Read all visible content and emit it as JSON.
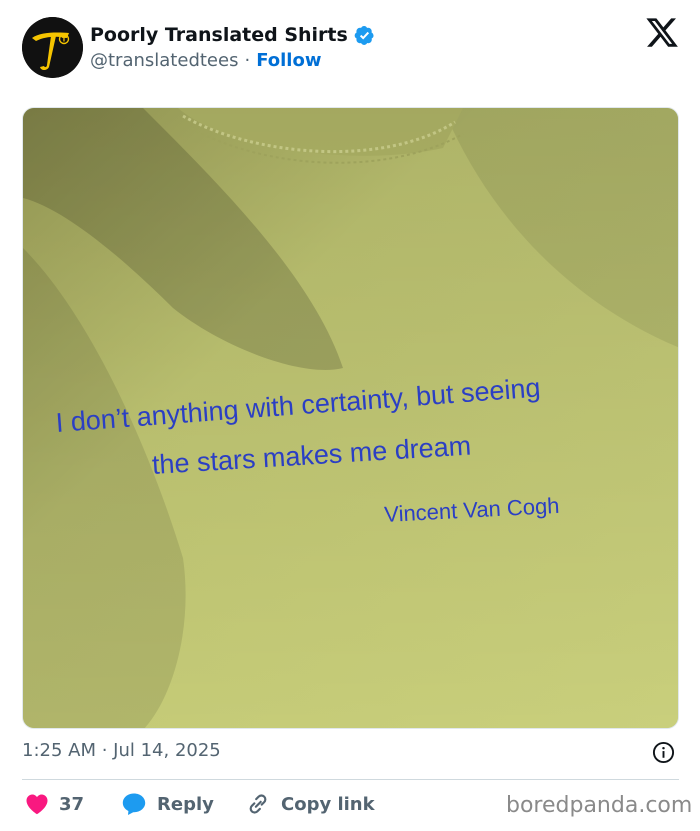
{
  "account": {
    "display_name": "Poorly Translated Shirts",
    "handle": "@translatedtees",
    "separator": "·",
    "follow_label": "Follow",
    "verified": true,
    "avatar_icon": "yellow-t-logo-icon"
  },
  "platform_icon": "x-logo-icon",
  "media": {
    "shirt_color": "#c4ca75",
    "print_color": "#2b3fc4",
    "text_lines": [
      "I don’t anything with certainty, but seeing",
      "the stars makes me dream",
      "Vincent Van Cogh"
    ]
  },
  "timestamp": "1:25 AM · Jul 14, 2025",
  "actions": {
    "like_count": "37",
    "reply_label": "Reply",
    "copy_label": "Copy link"
  },
  "watermark": "boredpanda.com",
  "colors": {
    "like": "#f91880",
    "reply": "#1d9bf0",
    "follow": "#006fd6",
    "verified": "#1d9bf0",
    "muted": "#536471"
  }
}
